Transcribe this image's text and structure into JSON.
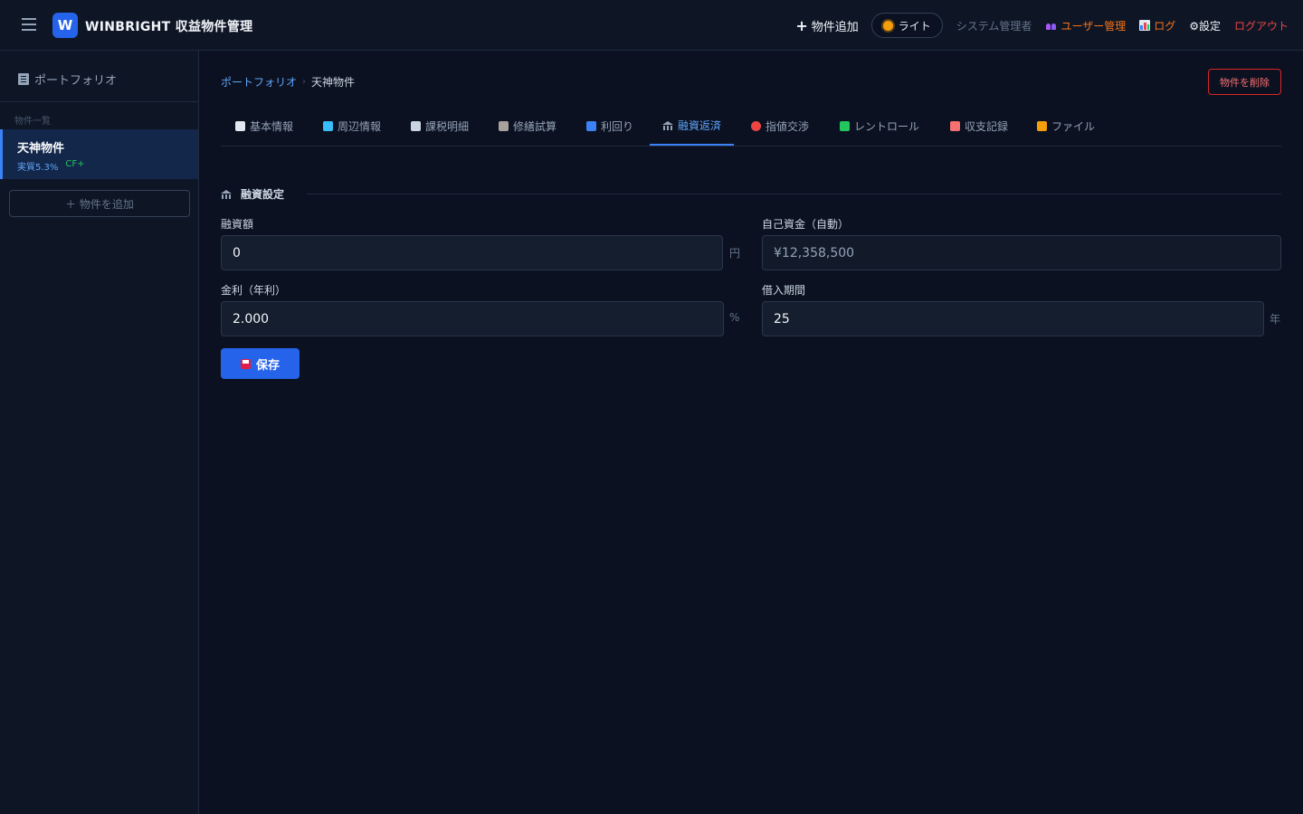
{
  "app": {
    "logo_letter": "W",
    "title": "WINBRIGHT 収益物件管理"
  },
  "header": {
    "add_property": "物件追加",
    "theme_toggle": "ライト",
    "role": "システム管理者",
    "user_management": "ユーザー管理",
    "log": "ログ",
    "settings": "⚙設定",
    "logout": "ログアウト"
  },
  "sidebar": {
    "portfolio": "ポートフォリオ",
    "section_label": "物件一覧",
    "properties": [
      {
        "name": "天神物件",
        "yield": "実質5.3%",
        "cf": "CF+"
      }
    ],
    "add_button": "＋ 物件を追加"
  },
  "breadcrumb": {
    "root": "ポートフォリオ",
    "separator": "›",
    "current": "天神物件"
  },
  "delete_button": "物件を削除",
  "tabs": [
    {
      "label": "基本情報",
      "icon": "memo-icon",
      "color": "#e2e8f0"
    },
    {
      "label": "周辺情報",
      "icon": "map-icon",
      "color": "#38bdf8"
    },
    {
      "label": "課税明細",
      "icon": "receipt-icon",
      "color": "#cbd5e1"
    },
    {
      "label": "修繕試算",
      "icon": "hammer-icon",
      "color": "#a8a29e"
    },
    {
      "label": "利回り",
      "icon": "bar-chart-icon",
      "color": "#3b82f6"
    },
    {
      "label": "融資返済",
      "icon": "bank-icon",
      "color": "#94a3b8"
    },
    {
      "label": "指値交渉",
      "icon": "target-icon",
      "color": "#ef4444"
    },
    {
      "label": "レントロール",
      "icon": "house-icon",
      "color": "#22c55e"
    },
    {
      "label": "収支記録",
      "icon": "document-icon",
      "color": "#f87171"
    },
    {
      "label": "ファイル",
      "icon": "folder-icon",
      "color": "#f59e0b"
    }
  ],
  "active_tab": "融資返済",
  "loan": {
    "section_title": "融資設定",
    "loan_amount": {
      "label": "融資額",
      "value": "0",
      "unit": "円"
    },
    "equity": {
      "label": "自己資金（自動）",
      "value": "¥12,358,500"
    },
    "interest": {
      "label": "金利（年利）",
      "value": "2.000",
      "unit": "%"
    },
    "term": {
      "label": "借入期間",
      "value": "25",
      "unit": "年"
    },
    "save_button": "保存"
  },
  "colors": {
    "background": "#0b1120",
    "accent": "#2563eb",
    "danger": "#ef4444",
    "warning": "#f97316",
    "success": "#22c55e"
  }
}
